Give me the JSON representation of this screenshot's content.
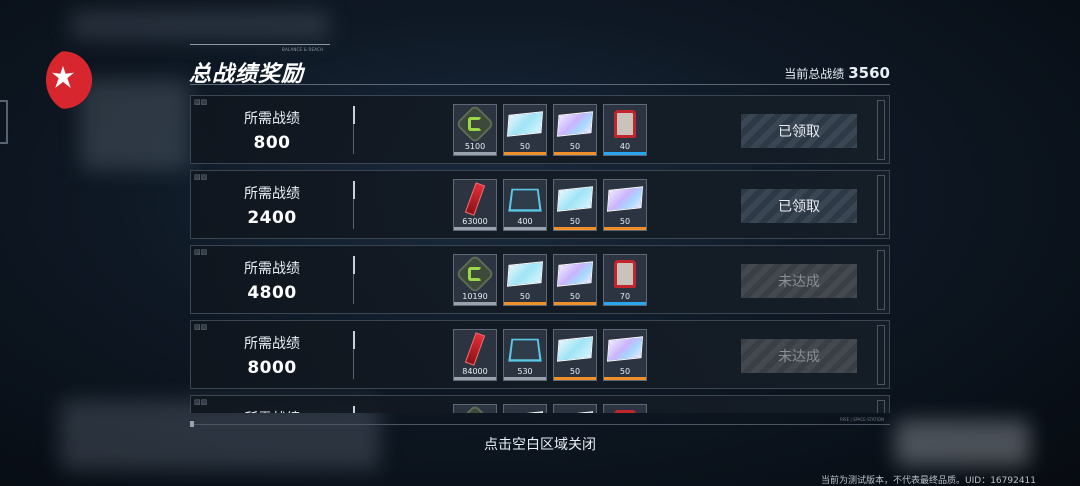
{
  "header": {
    "deco_text": "BALANCE & REACH",
    "title": "总战绩奖励",
    "total_label": "当前总战绩",
    "total_value": "3560"
  },
  "tiers": [
    {
      "label": "所需战绩",
      "required": "800",
      "status": "已领取",
      "status_state": "claimed",
      "rewards": [
        {
          "icon": "chip-icon",
          "qty": "5100",
          "rarity": "gray"
        },
        {
          "icon": "blue-card-icon",
          "qty": "50",
          "rarity": "orange"
        },
        {
          "icon": "purple-card-icon",
          "qty": "50",
          "rarity": "orange"
        },
        {
          "icon": "chair-icon",
          "qty": "40",
          "rarity": "blue"
        }
      ]
    },
    {
      "label": "所需战绩",
      "required": "2400",
      "status": "已领取",
      "status_state": "claimed",
      "rewards": [
        {
          "icon": "red-bar-icon",
          "qty": "63000",
          "rarity": "gray"
        },
        {
          "icon": "circuit-board-icon",
          "qty": "400",
          "rarity": "gray"
        },
        {
          "icon": "blue-card-icon",
          "qty": "50",
          "rarity": "orange"
        },
        {
          "icon": "purple-card-icon",
          "qty": "50",
          "rarity": "orange"
        }
      ]
    },
    {
      "label": "所需战绩",
      "required": "4800",
      "status": "未达成",
      "status_state": "locked",
      "rewards": [
        {
          "icon": "chip-icon",
          "qty": "10190",
          "rarity": "gray"
        },
        {
          "icon": "blue-card-icon",
          "qty": "50",
          "rarity": "orange"
        },
        {
          "icon": "purple-card-icon",
          "qty": "50",
          "rarity": "orange"
        },
        {
          "icon": "chair-icon",
          "qty": "70",
          "rarity": "blue"
        }
      ]
    },
    {
      "label": "所需战绩",
      "required": "8000",
      "status": "未达成",
      "status_state": "locked",
      "rewards": [
        {
          "icon": "red-bar-icon",
          "qty": "84000",
          "rarity": "gray"
        },
        {
          "icon": "circuit-board-icon",
          "qty": "530",
          "rarity": "gray"
        },
        {
          "icon": "blue-card-icon",
          "qty": "50",
          "rarity": "orange"
        },
        {
          "icon": "purple-card-icon",
          "qty": "50",
          "rarity": "orange"
        }
      ]
    },
    {
      "label": "所需战绩",
      "required": "",
      "status": "",
      "status_state": "locked",
      "rewards": [
        {
          "icon": "chip-icon",
          "qty": "",
          "rarity": "gray"
        },
        {
          "icon": "blue-card-icon",
          "qty": "",
          "rarity": "orange"
        },
        {
          "icon": "purple-card-icon",
          "qty": "",
          "rarity": "orange"
        },
        {
          "icon": "chair-icon",
          "qty": "",
          "rarity": "blue"
        }
      ]
    }
  ],
  "footer": {
    "deco_text": "RISE | SPACE-STATION",
    "close_hint": "点击空白区域关闭",
    "version_notice": "当前为测试版本，不代表最终品质。UID：16792411"
  }
}
